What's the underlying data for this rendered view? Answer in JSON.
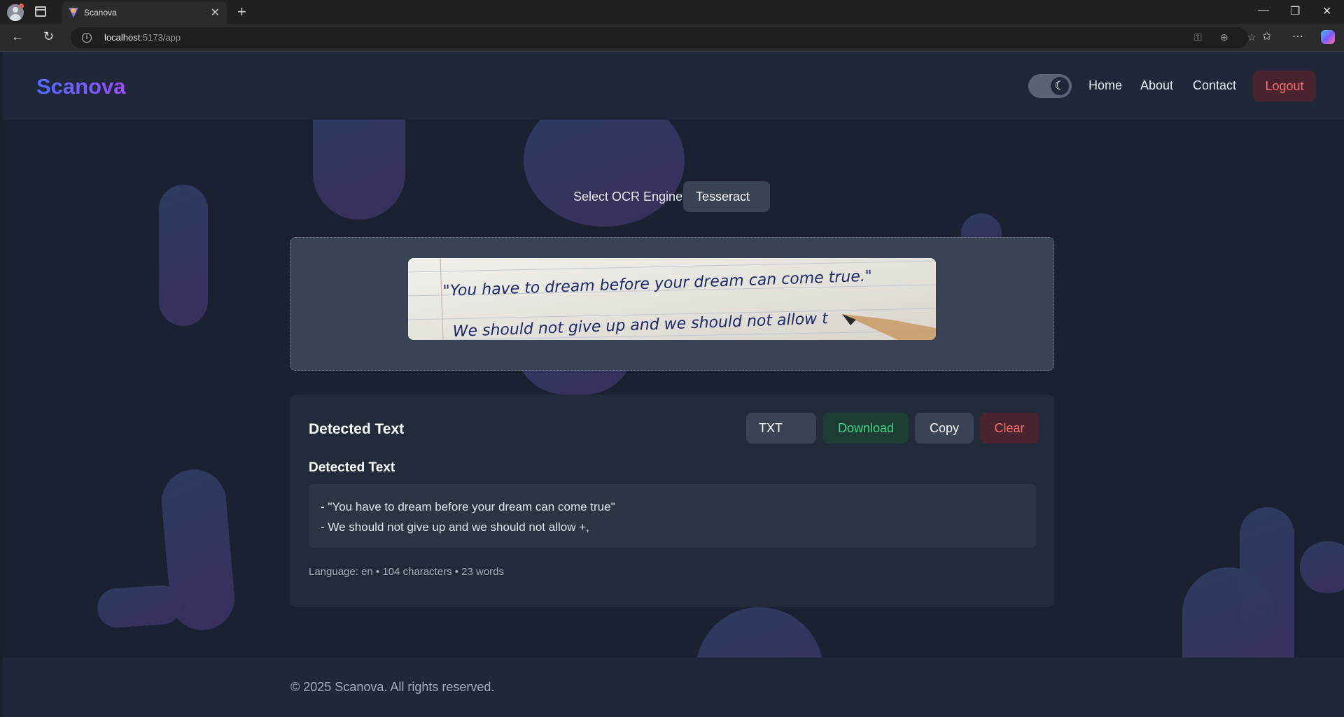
{
  "browser": {
    "tab_title": "Scanova",
    "url_host": "localhost",
    "url_path": ":5173/app"
  },
  "header": {
    "brand": "Scanova",
    "nav": [
      "Home",
      "About",
      "Contact"
    ],
    "logout_label": "Logout",
    "theme_icon": "moon-icon"
  },
  "ocr": {
    "engine_label": "Select OCR Engine:",
    "engine_value": "Tesseract"
  },
  "preview_image": {
    "line1": "\"You have to dream before your dream can come true.\"",
    "line2": "We should not give up and we should not allow t"
  },
  "result": {
    "title": "Detected Text",
    "format_value": "TXT",
    "download_label": "Download",
    "copy_label": "Copy",
    "clear_label": "Clear",
    "subtitle": "Detected Text",
    "lines": [
      "- \"You have to dream before your dream can come true\"",
      "- We should not give up and we should not allow +,"
    ],
    "stats": "Language: en • 104 characters • 23 words"
  },
  "footer": {
    "copyright": "© 2025 Scanova. All rights reserved."
  },
  "colors": {
    "brand_gradient_start": "#4f6bff",
    "brand_gradient_end": "#9b4dff",
    "download_green": "#3fd38a",
    "danger_red": "#ff6b6b"
  }
}
